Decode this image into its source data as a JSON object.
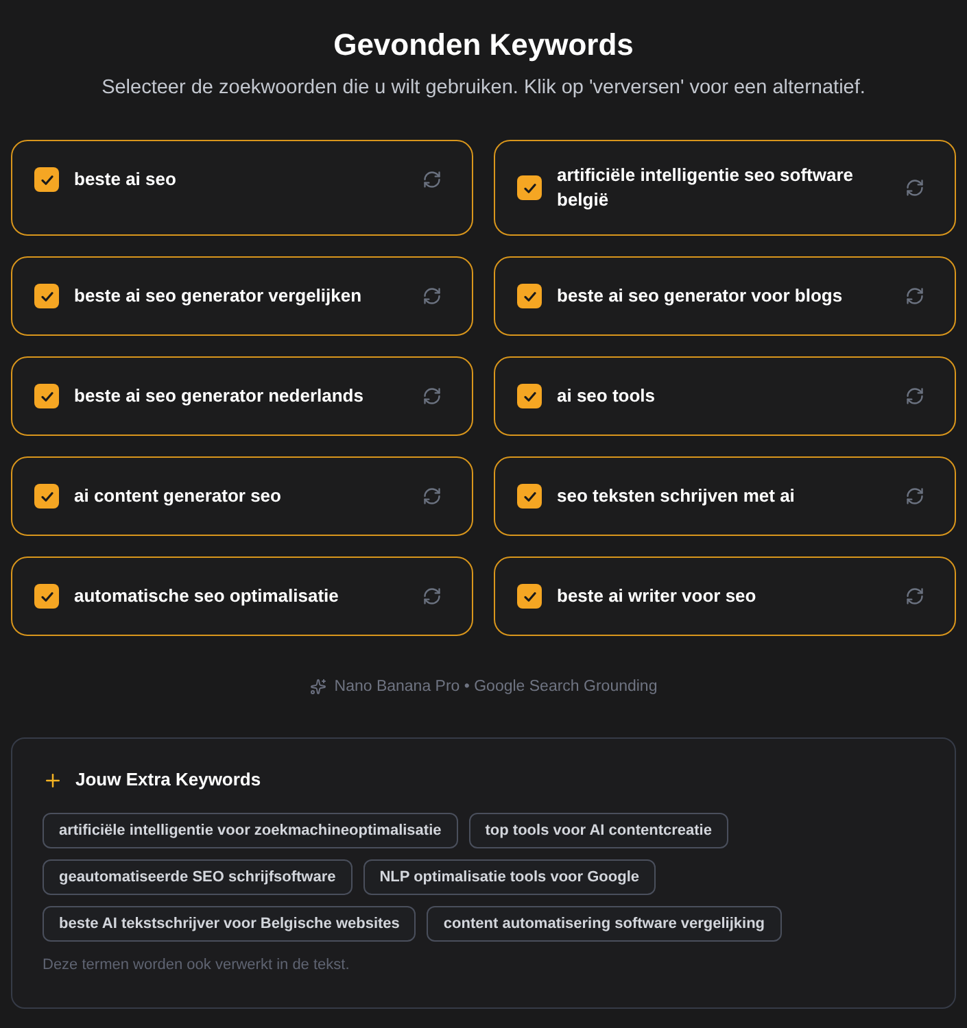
{
  "header": {
    "title": "Gevonden Keywords",
    "subtitle": "Selecteer de zoekwoorden die u wilt gebruiken. Klik op 'verversen' voor een alternatief."
  },
  "keywords": [
    {
      "label": "beste ai seo",
      "checked": true
    },
    {
      "label": "artificiële intelligentie seo software belgië",
      "checked": true
    },
    {
      "label": "beste ai seo generator vergelijken",
      "checked": true
    },
    {
      "label": "beste ai seo generator voor blogs",
      "checked": true
    },
    {
      "label": "beste ai seo generator nederlands",
      "checked": true
    },
    {
      "label": "ai seo tools",
      "checked": true
    },
    {
      "label": "ai content generator seo",
      "checked": true
    },
    {
      "label": "seo teksten schrijven met ai",
      "checked": true
    },
    {
      "label": "automatische seo optimalisatie",
      "checked": true
    },
    {
      "label": "beste ai writer voor seo",
      "checked": true
    }
  ],
  "footer": {
    "text": "Nano Banana Pro • Google Search Grounding"
  },
  "extra_keywords": {
    "title": "Jouw Extra Keywords",
    "chips": [
      "artificiële intelligentie voor zoekmachineoptimalisatie",
      "top tools voor AI contentcreatie",
      "geautomatiseerde SEO schrijfsoftware",
      "NLP optimalisatie tools voor Google",
      "beste AI tekstschrijver voor Belgische websites",
      "content automatisering software vergelijking"
    ],
    "note": "Deze termen worden ook verwerkt in de tekst."
  }
}
